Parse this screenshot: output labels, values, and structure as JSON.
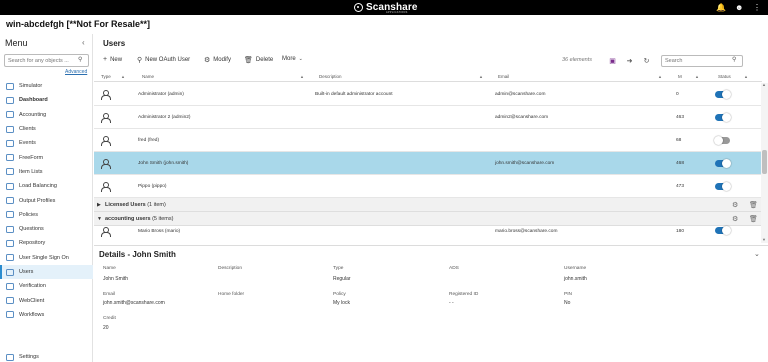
{
  "brand": {
    "name": "Scanshare",
    "sub": "APPLICATIONS"
  },
  "host": "win-abcdefgh [**Not For Resale**]",
  "sidebar": {
    "title": "Menu",
    "search_placeholder": "Search for any objects ...",
    "advanced": "Advanced",
    "items": [
      {
        "label": "Simulator"
      },
      {
        "label": "Dashboard"
      },
      {
        "label": "Accounting"
      },
      {
        "label": "Clients"
      },
      {
        "label": "Events"
      },
      {
        "label": "FreeForm"
      },
      {
        "label": "Item Lists"
      },
      {
        "label": "Load Balancing"
      },
      {
        "label": "Output Profiles"
      },
      {
        "label": "Policies"
      },
      {
        "label": "Questions"
      },
      {
        "label": "Repository"
      },
      {
        "label": "User Single Sign On"
      },
      {
        "label": "Users"
      },
      {
        "label": "Verification"
      },
      {
        "label": "WebClient"
      },
      {
        "label": "Workflows"
      }
    ],
    "settings": "Settings"
  },
  "main": {
    "title": "Users",
    "toolbar": {
      "new": "New",
      "new_oauth": "New OAuth User",
      "modify": "Modify",
      "delete": "Delete",
      "more": "More"
    },
    "count": "36 elements",
    "search_placeholder": "Search",
    "columns": {
      "type": "Type",
      "name": "Name",
      "description": "Description",
      "email": "Email",
      "m": "M",
      "status": "Status"
    },
    "rows": [
      {
        "name": "Administrator (admin)",
        "description": "Built-in default administrator account",
        "email": "admin@scanshare.com",
        "m": "0",
        "enabled": true
      },
      {
        "name": "Administrator 2 (admin2)",
        "description": "",
        "email": "admin2@scanshare.com",
        "m": "463",
        "enabled": true
      },
      {
        "name": "fred (fred)",
        "description": "",
        "email": "",
        "m": "68",
        "enabled": false
      },
      {
        "name": "John Smith (john.smith)",
        "description": "",
        "email": "john.smith@scanshare.com",
        "m": "468",
        "enabled": true
      },
      {
        "name": "Pippo (pippo)",
        "description": "",
        "email": "",
        "m": "473",
        "enabled": true
      }
    ],
    "groups": [
      {
        "name": "Licensed Users",
        "count": "(1 item)"
      },
      {
        "name": "accounting users",
        "count": "(5 items)"
      }
    ],
    "group_row": {
      "name": "Mario Bross (mario)",
      "email": "mario.bross@scanshare.com",
      "m": "180",
      "enabled": true
    }
  },
  "details": {
    "title": "Details - John Smith",
    "name_label": "Name",
    "name": "John Smith",
    "description_label": "Description",
    "type_label": "Type",
    "type": "Regular",
    "ads_label": "ADS",
    "username_label": "Username",
    "username": "john.smith",
    "email_label": "Email",
    "email": "john.smith@scanshare.com",
    "home_label": "Home folder",
    "policy_label": "Policy",
    "policy": "My lock",
    "registered_label": "Registered ID",
    "registered": "- -",
    "pin_label": "PIN",
    "pin": "No",
    "credit_label": "Credit",
    "credit": "20"
  }
}
